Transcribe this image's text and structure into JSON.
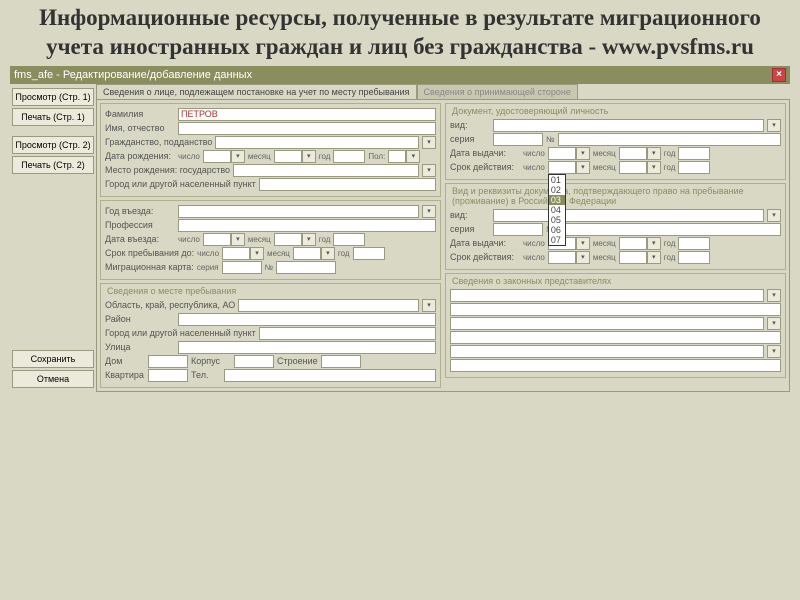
{
  "header": "Информационные ресурсы, полученные в результате миграционного учета иностранных граждан и лиц без гражданства - www.pvsfms.ru",
  "window_title": "fms_afe - Редактирование/добавление данных",
  "sidebar": {
    "preview1": "Просмотр (Стр. 1)",
    "print1": "Печать (Стр. 1)",
    "preview2": "Просмотр (Стр. 2)",
    "print2": "Печать (Стр. 2)",
    "save": "Сохранить",
    "cancel": "Отмена"
  },
  "tabs": {
    "active": "Сведения о лице, подлежащем постановке на учет по месту пребывания",
    "inactive": "Сведения о принимающей стороне"
  },
  "labels": {
    "surname": "Фамилия",
    "name_patronymic": "Имя, отчество",
    "citizenship": "Гражданство, подданство",
    "birth_date": "Дата рождения:",
    "day": "число",
    "month": "месяц",
    "year": "год",
    "sex": "Пол:",
    "birth_place": "Место рождения: государство",
    "city_other": "Город или другой населенный пункт",
    "entry_year": "Год въезда:",
    "profession": "Профессия",
    "entry_date": "Дата въезда:",
    "stay_until": "Срок пребывания до:",
    "migr_card": "Миграционная карта:",
    "series": "серия",
    "number": "№",
    "residence_info": "Сведения о месте пребывания",
    "region": "Область, край, республика, АО",
    "district": "Район",
    "city": "Город или другой населенный пункт",
    "street": "Улица",
    "house": "Дом",
    "building": "Корпус",
    "structure": "Строение",
    "apartment": "Квартира",
    "phone": "Тел.",
    "id_doc": "Документ, удостоверяющий личность",
    "kind": "вид:",
    "issue_date": "Дата выдачи:",
    "valid_until": "Срок действия:",
    "right_doc": "Вид и реквизиты документа, подтверждающего право на пребывание (проживание) в Российской Федерации",
    "issue_date2": "Дата выдачи:",
    "valid_until2": "Срок действия:",
    "legal_rep": "Сведения о законных представителях"
  },
  "values": {
    "surname": "ПЕТРОВ"
  },
  "dropdown_options": [
    "01",
    "02",
    "03",
    "04",
    "05",
    "06",
    "07"
  ]
}
